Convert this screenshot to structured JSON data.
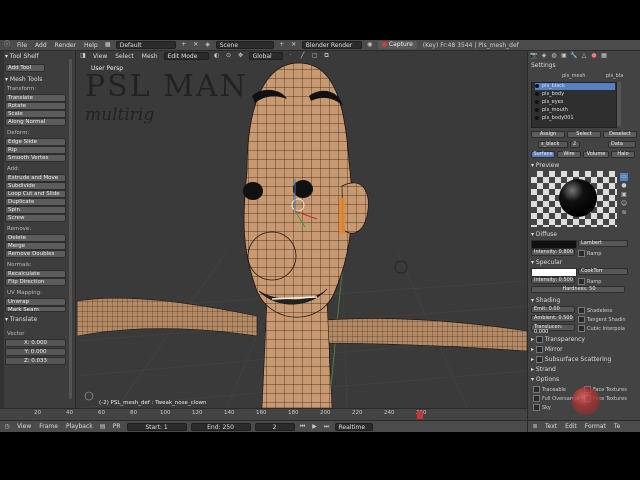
{
  "header": {
    "menus": [
      "File",
      "Add",
      "Render",
      "Help"
    ],
    "screen_layout": "Default",
    "scene": "Scene",
    "render_engine": "Blender Render",
    "capture_label": "Capture",
    "stats": "(Key) Fr:48 3544 | Pls_mesh_def"
  },
  "toolshelf": {
    "tool_shelf_label": "Tool Shelf",
    "add_tool_label": "Add Tool",
    "mesh_tools_label": "Mesh Tools",
    "transform_label": "Transform:",
    "transform_buttons": [
      "Translate",
      "Rotate",
      "Scale",
      "Along Normal"
    ],
    "deform_label": "Deform:",
    "deform_buttons": [
      "Edge Slide",
      "Rip",
      "Smooth Vertex"
    ],
    "add_label": "Add:",
    "add_buttons": [
      "Extrude and Move",
      "Subdivide",
      "Loop Cut and Slide",
      "Duplicate",
      "Spin",
      "Screw"
    ],
    "remove_label": "Remove:",
    "remove_buttons": [
      "Delete",
      "Merge",
      "Remove Doubles"
    ],
    "normals_label": "Normals:",
    "normals_buttons": [
      "Recalculate",
      "Flip Direction"
    ],
    "uv_label": "UV Mapping:",
    "uv_buttons": [
      "Unwrap",
      "Mark Seam"
    ],
    "translate_label": "Translate",
    "vector_label": "Vector",
    "vector": {
      "x": "X: 0.000",
      "y": "Y: 0.000",
      "z": "Z: 0.033"
    }
  },
  "viewport": {
    "header_items": [
      "View",
      "Select",
      "Mesh"
    ],
    "mode": "Edit Mode",
    "orientation": "Global",
    "view_label": "User Persp",
    "watermark_line1": "PSL MAN",
    "watermark_line2": "multirig",
    "status": "(-2) PSL_mesh_def : Tweak_nose_clown"
  },
  "timeline": {
    "ticks": [
      "20",
      "40",
      "60",
      "80",
      "100",
      "120",
      "140",
      "160",
      "180",
      "200",
      "220",
      "240",
      "260"
    ],
    "menus": [
      "View",
      "Frame",
      "Playback"
    ],
    "pr_label": "PR",
    "start": "Start: 1",
    "end": "End: 250",
    "current": "2",
    "sync": "Realtime"
  },
  "properties": {
    "settings_label": "Settings",
    "context_object": "pls_mesh",
    "context_material": "pls_bla",
    "materials": [
      "pls_black",
      "pls_body",
      "pls_eyes",
      "pls_mouth",
      "pls_body001"
    ],
    "assign": "Assign",
    "select": "Select",
    "deselect": "Deselect",
    "material_name": "s_black",
    "material_users": "2",
    "data_label": "Data",
    "tabs": [
      "Surface",
      "Wire",
      "Volume",
      "Halo"
    ],
    "preview_label": "Preview",
    "diffuse_label": "Diffuse",
    "diffuse_shader": "Lambert",
    "diffuse_intensity": "Intensity: 0.800",
    "ramp": "Ramp",
    "specular_label": "Specular",
    "specular_shader": "CookTorr",
    "specular_intensity": "Intensity: 0.500",
    "hardness": "Hardness: 50",
    "shading_label": "Shading",
    "emit": "Emit: 0.00",
    "ambient": "Ambient: 0.500",
    "translucency": "Translucen: 0.000",
    "shadeless": "Shadeless",
    "tangent_shading": "Tangent Shadin",
    "cubic": "Cubic Interpola",
    "transparency_label": "Transparency",
    "mirror_label": "Mirror",
    "sss_label": "Subsurface Scattering",
    "strand_label": "Strand",
    "options_label": "Options",
    "traceable": "Traceable",
    "full_oversampling": "Full Oversampl",
    "face_textures": "Face Textures",
    "face_textures_alpha": "Face Textures",
    "sky": "Sky",
    "bottom_menus": [
      "Text",
      "Edit",
      "Format",
      "Te"
    ],
    "colors": {
      "diffuse": "#111111",
      "specular": "#ffffff",
      "accent": "#5680c2",
      "active_tab": "#5680c2"
    }
  }
}
